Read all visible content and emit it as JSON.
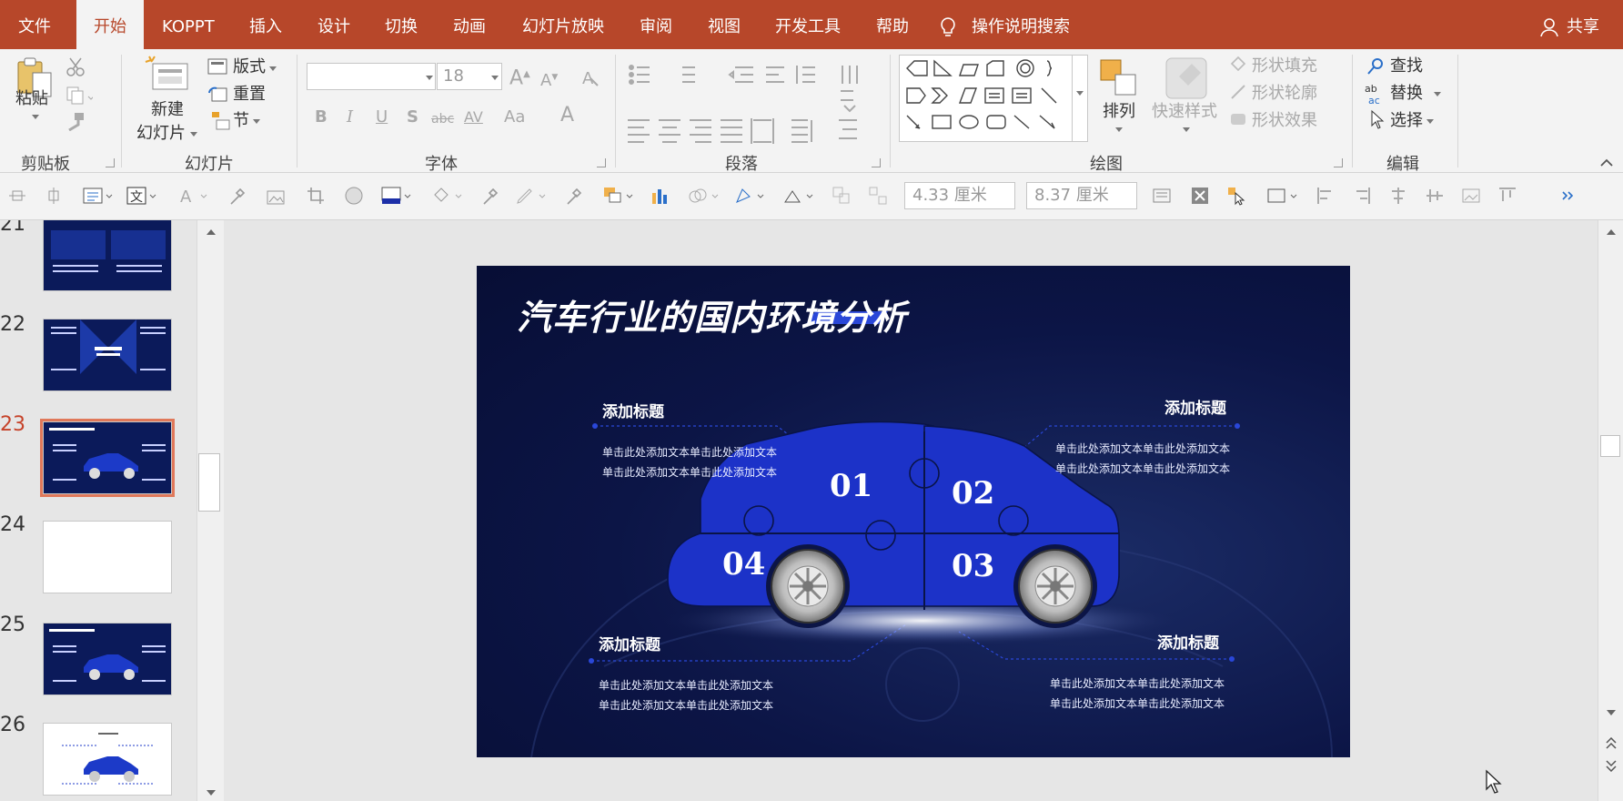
{
  "tabs": [
    "文件",
    "开始",
    "KOPPT",
    "插入",
    "设计",
    "切换",
    "动画",
    "幻灯片放映",
    "审阅",
    "视图",
    "开发工具",
    "帮助"
  ],
  "active_tab": "开始",
  "search_label": "操作说明搜索",
  "share_label": "共享",
  "ribbon": {
    "clipboard": {
      "label": "剪贴板",
      "paste": "粘贴"
    },
    "slides": {
      "label": "幻灯片",
      "new_slide_1": "新建",
      "new_slide_2": "幻灯片",
      "layout": "版式",
      "reset": "重置",
      "section": "节"
    },
    "font": {
      "label": "字体",
      "size": "18",
      "b": "B",
      "i": "I",
      "u": "U",
      "s": "S",
      "abc": "abc",
      "av": "AV",
      "aa": "Aa",
      "a": "A"
    },
    "paragraph": {
      "label": "段落"
    },
    "drawing": {
      "label": "绘图",
      "arrange": "排列",
      "quick_styles": "快速样式",
      "fill": "形状填充",
      "outline": "形状轮廓",
      "effects": "形状效果"
    },
    "editing": {
      "label": "编辑",
      "find": "查找",
      "replace": "替换",
      "select": "选择"
    }
  },
  "toolrow": {
    "height_value": "4.33 厘米",
    "width_value": "8.37 厘米"
  },
  "slides_panel": [
    {
      "num": "21",
      "style": "dark"
    },
    {
      "num": "22",
      "style": "dark"
    },
    {
      "num": "23",
      "style": "dark",
      "current": true
    },
    {
      "num": "24",
      "style": "light"
    },
    {
      "num": "25",
      "style": "dark"
    },
    {
      "num": "26",
      "style": "light"
    }
  ],
  "slide": {
    "title": "汽车行业的国内环境分析",
    "blocks": [
      {
        "head": "添加标题",
        "line1": "单击此处添加文本单击此处添加文本",
        "line2": "单击此处添加文本单击此处添加文本"
      },
      {
        "head": "添加标题",
        "line1": "单击此处添加文本单击此处添加文本",
        "line2": "单击此处添加文本单击此处添加文本"
      },
      {
        "head": "添加标题",
        "line1": "单击此处添加文本单击此处添加文本",
        "line2": "单击此处添加文本单击此处添加文本"
      },
      {
        "head": "添加标题",
        "line1": "单击此处添加文本单击此处添加文本",
        "line2": "单击此处添加文本单击此处添加文本"
      }
    ],
    "numbers": [
      "01",
      "02",
      "03",
      "04"
    ]
  },
  "colors": {
    "accent": "#b7472a",
    "slide_bg": "#0c1546",
    "car_blue": "#1c32c8"
  }
}
